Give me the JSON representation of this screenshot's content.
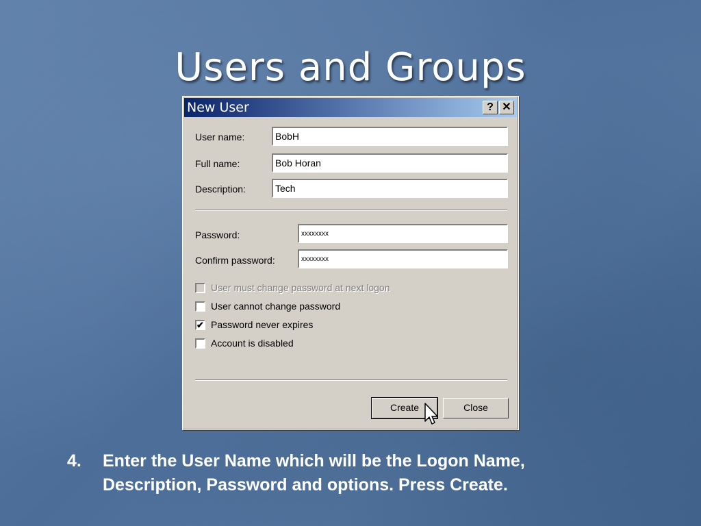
{
  "slide": {
    "title": "Users and Groups",
    "caption_number": "4.",
    "caption_text": "Enter the User Name which will be the Logon Name, Description, Password and options. Press Create."
  },
  "dialog": {
    "title": "New User",
    "help_label": "?",
    "close_label": "✕",
    "labels": {
      "user_name": "User name:",
      "full_name": "Full name:",
      "description": "Description:",
      "password": "Password:",
      "confirm_password": "Confirm password:"
    },
    "values": {
      "user_name": "BobH",
      "full_name": "Bob Horan",
      "description": "Tech",
      "password": "xxxxxxxx",
      "confirm_password": "xxxxxxxx"
    },
    "options": [
      {
        "label": "User must change password at next logon",
        "checked": false,
        "disabled": true
      },
      {
        "label": "User cannot change password",
        "checked": false,
        "disabled": false
      },
      {
        "label": "Password never expires",
        "checked": true,
        "disabled": false
      },
      {
        "label": "Account is disabled",
        "checked": false,
        "disabled": false
      }
    ],
    "check_mark": "✔",
    "buttons": {
      "create": "Create",
      "close": "Close"
    }
  },
  "colors": {
    "titlebar_start": "#0a246a",
    "titlebar_end": "#a6caf0",
    "dialog_face": "#d4d0c8"
  }
}
